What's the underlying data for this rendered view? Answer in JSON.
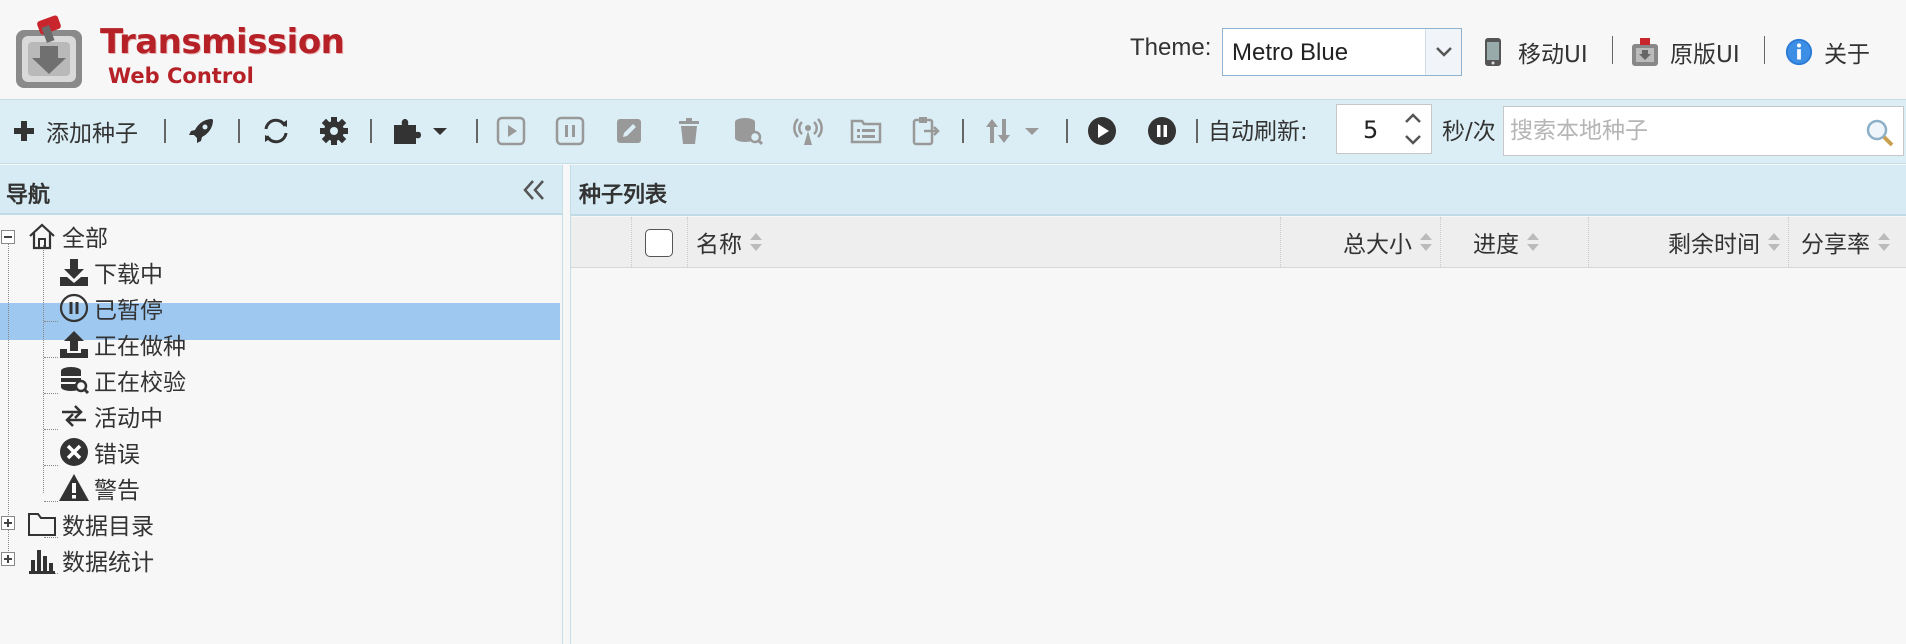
{
  "header": {
    "logo_title": "Transmission",
    "logo_subtitle": "Web Control",
    "theme_label": "Theme:",
    "theme_value": "Metro Blue",
    "links": {
      "mobile": "移动UI",
      "original": "原版UI",
      "about": "关于"
    }
  },
  "toolbar": {
    "add_torrent": "添加种子",
    "auto_refresh_label": "自动刷新:",
    "refresh_interval": "5",
    "interval_unit": "秒/次",
    "search_placeholder": "搜索本地种子"
  },
  "nav": {
    "title": "导航",
    "items": {
      "all": "全部",
      "downloading": "下载中",
      "paused": "已暂停",
      "seeding": "正在做种",
      "checking": "正在校验",
      "active": "活动中",
      "error": "错误",
      "warning": "警告",
      "folders": "数据目录",
      "statistics": "数据统计"
    },
    "selected": "downloading"
  },
  "list": {
    "title": "种子列表",
    "columns": {
      "name": "名称",
      "size": "总大小",
      "progress": "进度",
      "remaining": "剩余时间",
      "ratio": "分享率"
    }
  },
  "colors": {
    "brand": "#b52126",
    "toolbar_bg": "#dbeef5",
    "panel_header_bg": "#d6ebf3",
    "selection": "#9ec8f0"
  }
}
